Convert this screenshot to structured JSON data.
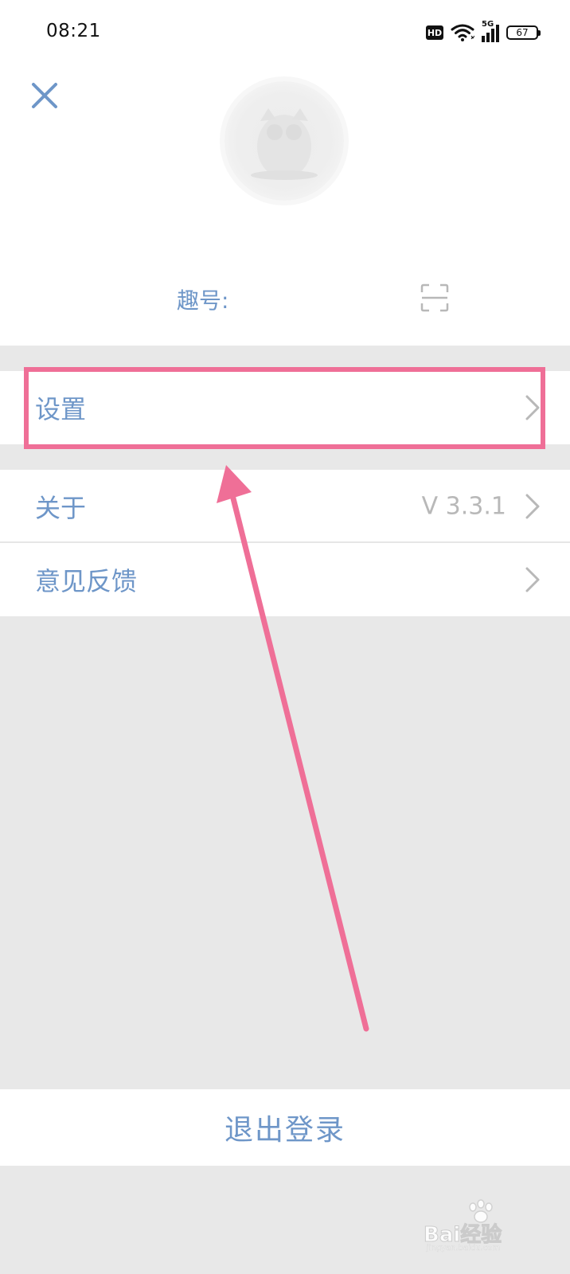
{
  "status_bar": {
    "time": "08:21",
    "hd": "HD",
    "network": "5G",
    "battery": "67",
    "icons": [
      "hd-icon",
      "wifi-icon",
      "5g-signal-icon",
      "battery-icon"
    ]
  },
  "header": {
    "close_icon": "close-icon",
    "qid_label": "趣号:",
    "qr_icon": "scan-frame-icon"
  },
  "menu": {
    "items": [
      {
        "label": "设置",
        "value": ""
      },
      {
        "label": "关于",
        "value": "V 3.3.1"
      },
      {
        "label": "意见反馈",
        "value": ""
      }
    ]
  },
  "logout": {
    "label": "退出登录"
  },
  "watermark": {
    "text": "Bai经验",
    "subtext": "jingyan.baidu.com"
  },
  "colors": {
    "accent": "#6e96c8",
    "annotation": "#ef6f97",
    "background": "#e8e8e8",
    "muted": "#b8b8b8"
  }
}
